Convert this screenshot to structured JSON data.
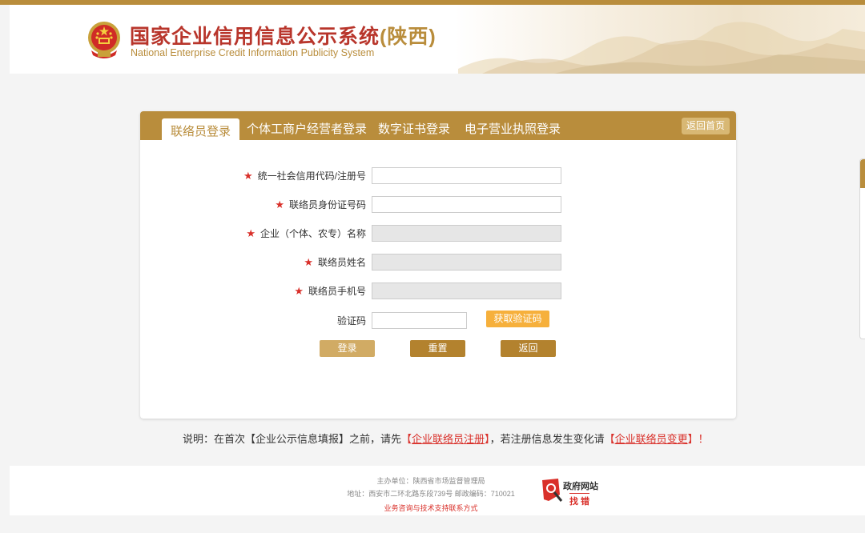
{
  "header": {
    "title": "国家企业信用信息公示系统",
    "province": "(陕西)",
    "subtitle": "National Enterprise Credit Information Publicity System"
  },
  "tabs": [
    {
      "label": "联络员登录",
      "active": true
    },
    {
      "label": "个体工商户经营者登录",
      "active": false
    },
    {
      "label": "数字证书登录",
      "active": false
    },
    {
      "label": "电子营业执照登录",
      "active": false
    }
  ],
  "home_button": "返回首页",
  "form": {
    "required_mark": "★",
    "fields": [
      {
        "label": "统一社会信用代码/注册号",
        "required": true,
        "disabled": false,
        "value": ""
      },
      {
        "label": "联络员身份证号码",
        "required": true,
        "disabled": false,
        "value": ""
      },
      {
        "label": "企业（个体、农专）名称",
        "required": true,
        "disabled": true,
        "value": ""
      },
      {
        "label": "联络员姓名",
        "required": true,
        "disabled": true,
        "value": ""
      },
      {
        "label": "联络员手机号",
        "required": true,
        "disabled": true,
        "value": ""
      }
    ],
    "captcha_label": "验证码",
    "captcha_value": "",
    "get_code_button": "获取验证码",
    "login_button": "登录",
    "reset_button": "重置",
    "back_button": "返回"
  },
  "note": {
    "prefix": "说明：在首次【企业公示信息填报】之前，请先",
    "link1": "企业联络员注册",
    "middle": "，若注册信息发生变化请",
    "link2": "企业联络员变更",
    "suffix": "！"
  },
  "footer": {
    "sponsor": "主办单位：陕西省市场监督管理局",
    "address": "地址：西安市二环北路东段739号    邮政编码：710021",
    "contact": "业务咨询与技术支持联系方式",
    "gov_badge_title": "政府网站",
    "gov_badge_sub": "找 错"
  },
  "colors": {
    "brand_gold": "#b98d3c",
    "title_red": "#b8352b",
    "required_red": "#d9302a",
    "code_button": "#f6b03c"
  }
}
